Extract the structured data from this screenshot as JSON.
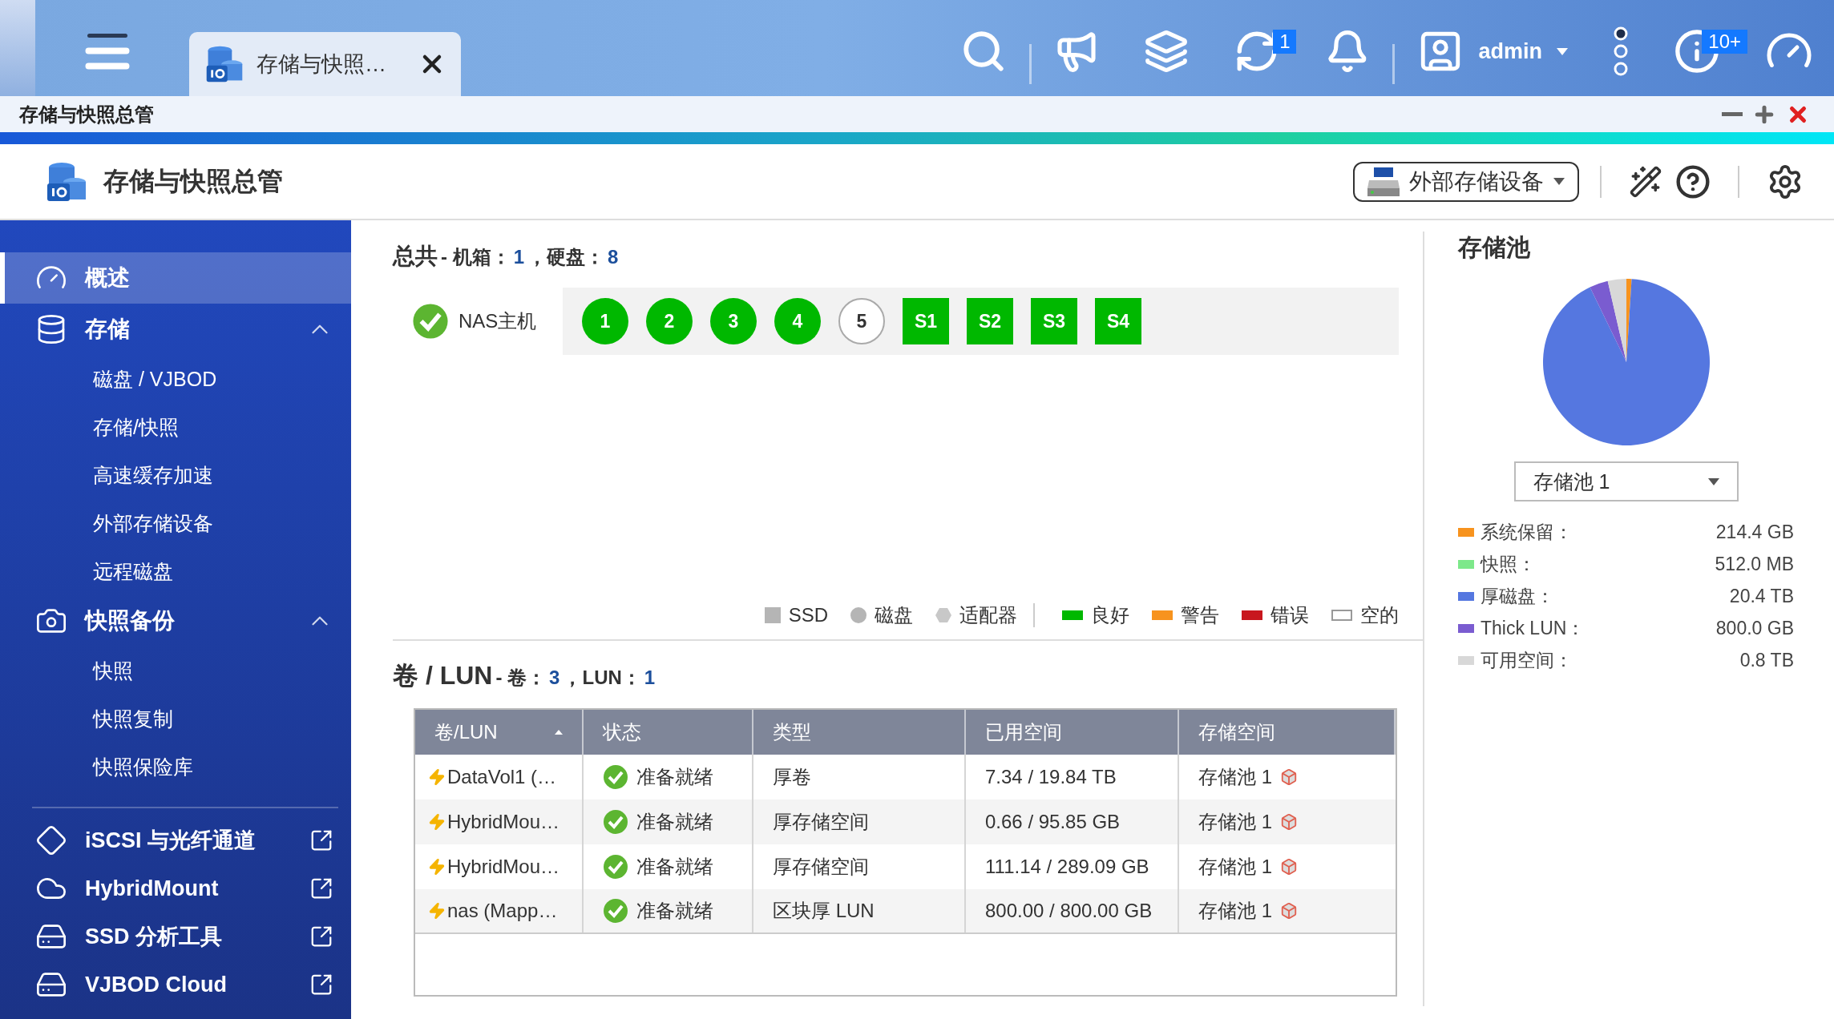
{
  "topbar": {
    "tab": {
      "title": "存储与快照…",
      "selected": true
    },
    "sync_badge": "1",
    "user": "admin",
    "info_badge": "10+"
  },
  "window": {
    "title": "存储与快照总管"
  },
  "header": {
    "title": "存储与快照总管",
    "device_button": "外部存储设备"
  },
  "nav": [
    {
      "label": "概述",
      "selected": true
    },
    {
      "label": "存储",
      "selected": false,
      "expanded": true,
      "children": [
        {
          "label": "磁盘 / VJBOD",
          "selected": false
        },
        {
          "label": "存储/快照",
          "selected": false
        },
        {
          "label": "高速缓存加速",
          "selected": false
        },
        {
          "label": "外部存储设备",
          "selected": false
        },
        {
          "label": "远程磁盘",
          "selected": false
        }
      ]
    },
    {
      "label": "快照备份",
      "selected": false,
      "expanded": true,
      "children": [
        {
          "label": "快照",
          "selected": false
        },
        {
          "label": "快照复制",
          "selected": false
        },
        {
          "label": "快照保险库",
          "selected": false
        }
      ]
    }
  ],
  "tools": [
    {
      "label": "iSCSI 与光纤通道"
    },
    {
      "label": "HybridMount"
    },
    {
      "label": "SSD 分析工具"
    },
    {
      "label": "VJBOD Cloud"
    }
  ],
  "summary": {
    "title": "总共",
    "counts": [
      {
        "label": "- 机箱：",
        "value": "1"
      },
      {
        "label": "，硬盘：",
        "value": "8"
      }
    ],
    "host": {
      "label": "NAS主机",
      "healthy": true
    },
    "disks": [
      {
        "label": "1",
        "kind": "disk",
        "empty": false
      },
      {
        "label": "2",
        "kind": "disk",
        "empty": false
      },
      {
        "label": "3",
        "kind": "disk",
        "empty": false
      },
      {
        "label": "4",
        "kind": "disk",
        "empty": false
      },
      {
        "label": "5",
        "kind": "disk",
        "empty": true
      },
      {
        "label": "S1",
        "kind": "ssd",
        "empty": false
      },
      {
        "label": "S2",
        "kind": "ssd",
        "empty": false
      },
      {
        "label": "S3",
        "kind": "ssd",
        "empty": false
      },
      {
        "label": "S4",
        "kind": "ssd",
        "empty": false
      }
    ],
    "legend": [
      {
        "label": "SSD",
        "kind": "square"
      },
      {
        "label": "磁盘",
        "kind": "circle"
      },
      {
        "label": "适配器",
        "kind": "hexagon"
      },
      {
        "label": "良好",
        "kind": "bar",
        "color": "#00b800"
      },
      {
        "label": "警告",
        "kind": "bar",
        "color": "#f7931e"
      },
      {
        "label": "错误",
        "kind": "bar",
        "color": "#c8171e"
      },
      {
        "label": "空的",
        "kind": "outline"
      }
    ]
  },
  "volumes": {
    "title": "卷 / LUN",
    "counts": [
      {
        "label": "- 卷：",
        "value": "3"
      },
      {
        "label": "，LUN：",
        "value": "1"
      }
    ],
    "columns": [
      {
        "label": "卷/LUN",
        "sorted": true
      },
      {
        "label": "状态",
        "sorted": false
      },
      {
        "label": "类型",
        "sorted": false
      },
      {
        "label": "已用空间",
        "sorted": false
      },
      {
        "label": "存储空间",
        "sorted": false
      }
    ],
    "rows": [
      {
        "name": "DataVol1 (…",
        "status": "准备就绪",
        "type": "厚卷",
        "used": "7.34 / 19.84 TB",
        "pool": "存储池 1"
      },
      {
        "name": "HybridMou…",
        "status": "准备就绪",
        "type": "厚存储空间",
        "used": "0.66 / 95.85 GB",
        "pool": "存储池 1"
      },
      {
        "name": "HybridMou…",
        "status": "准备就绪",
        "type": "厚存储空间",
        "used": "111.14 / 289.09 GB",
        "pool": "存储池 1"
      },
      {
        "name": "nas (Mapp…",
        "status": "准备就绪",
        "type": "区块厚 LUN",
        "used": "800.00 / 800.00 GB",
        "pool": "存储池 1"
      }
    ]
  },
  "pool": {
    "title": "存储池",
    "selector": "存储池 1",
    "chart_data": {
      "type": "pie",
      "values": [
        1.0,
        91.8,
        3.6,
        3.6
      ],
      "colors": [
        "#f7931e",
        "#5577e0",
        "#7a5cd0",
        "#d8d8d8"
      ]
    },
    "legend": [
      {
        "label": "系统保留：",
        "value": "214.4 GB",
        "color": "#f7931e"
      },
      {
        "label": "快照：",
        "value": "512.0 MB",
        "color": "#7de88a"
      },
      {
        "label": "厚磁盘：",
        "value": "20.4 TB",
        "color": "#5577e0"
      },
      {
        "label": "Thick LUN：",
        "value": "800.0 GB",
        "color": "#7a5cd0"
      },
      {
        "label": "可用空间：",
        "value": "0.8 TB",
        "color": "#d8d8d8"
      }
    ]
  }
}
